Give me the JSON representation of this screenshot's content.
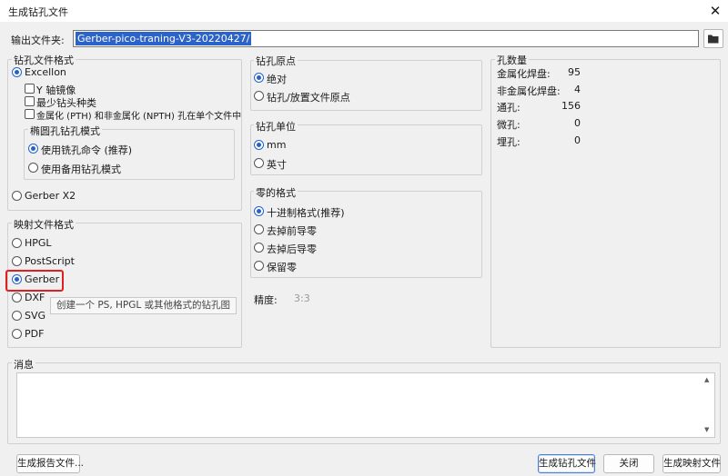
{
  "window": {
    "title": "生成钻孔文件",
    "close_glyph": "✕"
  },
  "output": {
    "label": "输出文件夹:",
    "value": "Gerber-pico-traning-V3-20220427/"
  },
  "drill_format": {
    "title": "钻孔文件格式",
    "excellon": "Excellon",
    "mirror_y": "Y 轴镜像",
    "minimal_header": "最少钻头种类",
    "merge_pth": "金属化 (PTH) 和非金属化 (NPTH) 孔在单个文件中",
    "oval": {
      "title": "椭圆孔钻孔模式",
      "use_route": "使用铣孔命令 (推荐)",
      "use_alt": "使用备用钻孔模式"
    },
    "gerber_x2": "Gerber X2"
  },
  "map_format": {
    "title": "映射文件格式",
    "options": [
      "HPGL",
      "PostScript",
      "Gerber",
      "DXF",
      "SVG",
      "PDF"
    ],
    "selected": "Gerber",
    "tooltip": "创建一个 PS, HPGL 或其他格式的钻孔图"
  },
  "origin": {
    "title": "钻孔原点",
    "absolute": "绝对",
    "aux": "钻孔/放置文件原点"
  },
  "units": {
    "title": "钻孔单位",
    "mm": "mm",
    "inch": "英寸"
  },
  "zeros": {
    "title": "零的格式",
    "decimal": "十进制格式(推荐)",
    "suppress_leading": "去掉前导零",
    "suppress_trailing": "去掉后导零",
    "keep_zeros": "保留零"
  },
  "precision": {
    "label": "精度:",
    "value": "3:3"
  },
  "hole_count": {
    "title": "孔数量",
    "rows": [
      {
        "label": "金属化焊盘:",
        "value": "95"
      },
      {
        "label": "非金属化焊盘:",
        "value": "4"
      },
      {
        "label": "通孔:",
        "value": "156"
      },
      {
        "label": "微孔:",
        "value": "0"
      },
      {
        "label": "埋孔:",
        "value": "0"
      }
    ]
  },
  "messages": {
    "title": "消息"
  },
  "buttons": {
    "report": "生成报告文件...",
    "generate_drill": "生成钻孔文件",
    "close": "关闭",
    "generate_map": "生成映射文件"
  },
  "colors": {
    "accent": "#2563c6",
    "highlight": "#e02020",
    "selection": "#2b63c9"
  }
}
